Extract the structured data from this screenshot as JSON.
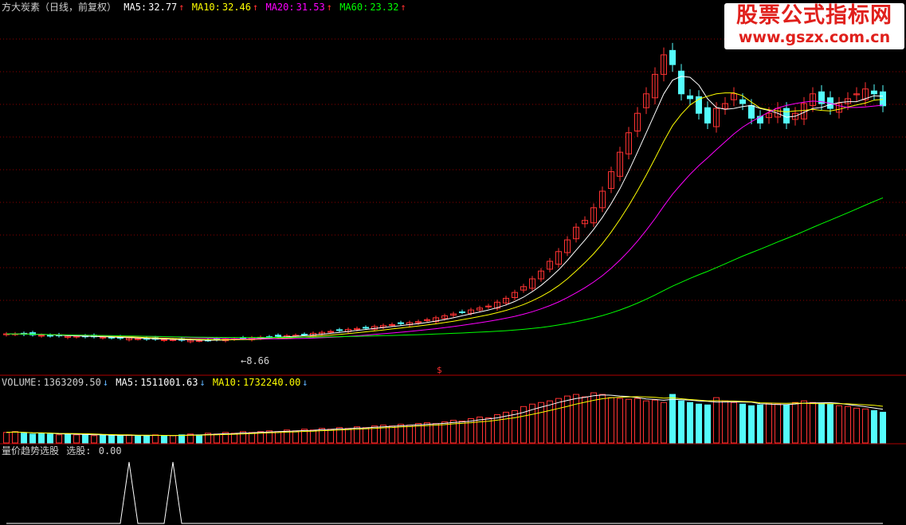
{
  "main_header": {
    "title": "方大炭素（日线，前复权）",
    "ma5_label": "MA5:",
    "ma5_value": "32.77",
    "ma10_label": "MA10:",
    "ma10_value": "32.46",
    "ma20_label": "MA20:",
    "ma20_value": "31.53",
    "ma60_label": "MA60:",
    "ma60_value": "23.32",
    "arrow_up": "↑"
  },
  "volume_header": {
    "volume_label": "VOLUME:",
    "volume_value": "1363209.50",
    "ma5_label": "MA5:",
    "ma5_value": "1511001.63",
    "ma10_label": "MA10:",
    "ma10_value": "1732240.00",
    "arrow_down": "↓"
  },
  "indicator_header": {
    "name": "量价趋势选股",
    "value_label": "选股:",
    "value": "0.00"
  },
  "watermark": {
    "line1": "股票公式指标网",
    "line2": "www.gszx.com.cn"
  },
  "colors": {
    "background": "#000000",
    "up_candle": "#ff3232",
    "down_candle": "#54fcfc",
    "ma5": "#ffffff",
    "ma10": "#ffff00",
    "ma20": "#ff00ff",
    "ma60": "#00ff00",
    "grid": "#8b0000",
    "indicator": "#ffffff"
  },
  "chart_data": {
    "type": "candlestick",
    "low_annotation": "8.66",
    "marker": "$",
    "price_series": [
      9.35,
      9.35,
      9.3,
      9.25,
      9.2,
      9.15,
      9.15,
      9.1,
      9.1,
      9.05,
      9.05,
      9.0,
      8.95,
      8.9,
      8.9,
      8.85,
      8.8,
      8.8,
      8.75,
      8.75,
      8.7,
      8.7,
      8.66,
      8.7,
      8.75,
      8.8,
      8.85,
      8.9,
      8.95,
      9.0,
      9.05,
      9.1,
      9.15,
      9.2,
      9.3,
      9.4,
      9.5,
      9.6,
      9.7,
      9.8,
      9.9,
      10.0,
      10.1,
      10.2,
      10.3,
      10.4,
      10.5,
      10.6,
      10.8,
      11.0,
      11.2,
      11.4,
      11.6,
      11.8,
      12.0,
      12.2,
      12.6,
      13.0,
      13.6,
      14.2,
      15.0,
      15.8,
      16.8,
      17.8,
      19.0,
      20.3,
      21.0,
      22.3,
      24.0,
      26.0,
      28.0,
      30.0,
      32.0,
      34.0,
      36.0,
      38.0,
      37.0,
      34.0,
      33.5,
      32.0,
      31.0,
      32.5,
      33.0,
      34.0,
      33.0,
      31.5,
      31.0,
      32.0,
      32.5,
      31.0,
      32.0,
      33.0,
      34.0,
      33.0,
      32.5,
      33.0,
      33.5,
      34.0,
      34.5,
      34.0,
      32.77
    ],
    "ma60_end": 23.32,
    "volume_series": [
      13,
      14,
      12,
      11,
      12,
      11,
      10,
      11,
      10,
      10,
      9,
      10,
      9,
      9,
      10,
      9,
      9,
      10,
      9,
      9,
      10,
      11,
      10,
      12,
      11,
      13,
      12,
      14,
      13,
      14,
      15,
      14,
      16,
      15,
      17,
      16,
      18,
      17,
      19,
      18,
      20,
      19,
      21,
      22,
      21,
      23,
      22,
      24,
      25,
      24,
      26,
      28,
      27,
      30,
      32,
      31,
      35,
      38,
      40,
      45,
      48,
      50,
      52,
      55,
      58,
      60,
      57,
      62,
      60,
      56,
      55,
      54,
      55,
      52,
      53,
      50,
      60,
      52,
      50,
      48,
      47,
      56,
      52,
      50,
      48,
      46,
      47,
      49,
      48,
      47,
      50,
      52,
      50,
      49,
      48,
      46,
      45,
      43,
      42,
      40,
      38
    ],
    "signal_series": [
      0,
      0,
      0,
      0,
      0,
      0,
      0,
      0,
      0,
      0,
      0,
      0,
      0,
      0,
      1,
      0,
      0,
      0,
      0,
      1,
      0,
      0,
      0,
      0,
      0,
      0,
      0,
      0,
      0,
      0,
      0,
      0,
      0,
      0,
      0,
      0,
      0,
      0,
      0,
      0,
      0,
      0,
      0,
      0,
      0,
      0,
      0,
      0,
      0,
      0,
      0,
      0,
      0,
      0,
      0,
      0,
      0,
      0,
      0,
      0,
      0,
      0,
      0,
      0,
      0,
      0,
      0,
      0,
      0,
      0,
      0,
      0,
      0,
      0,
      0,
      0,
      0,
      0,
      0,
      0,
      0,
      0,
      0,
      0,
      0,
      0,
      0,
      0,
      0,
      0,
      0,
      0,
      0,
      0,
      0,
      0,
      0,
      0,
      0,
      0,
      0
    ]
  }
}
